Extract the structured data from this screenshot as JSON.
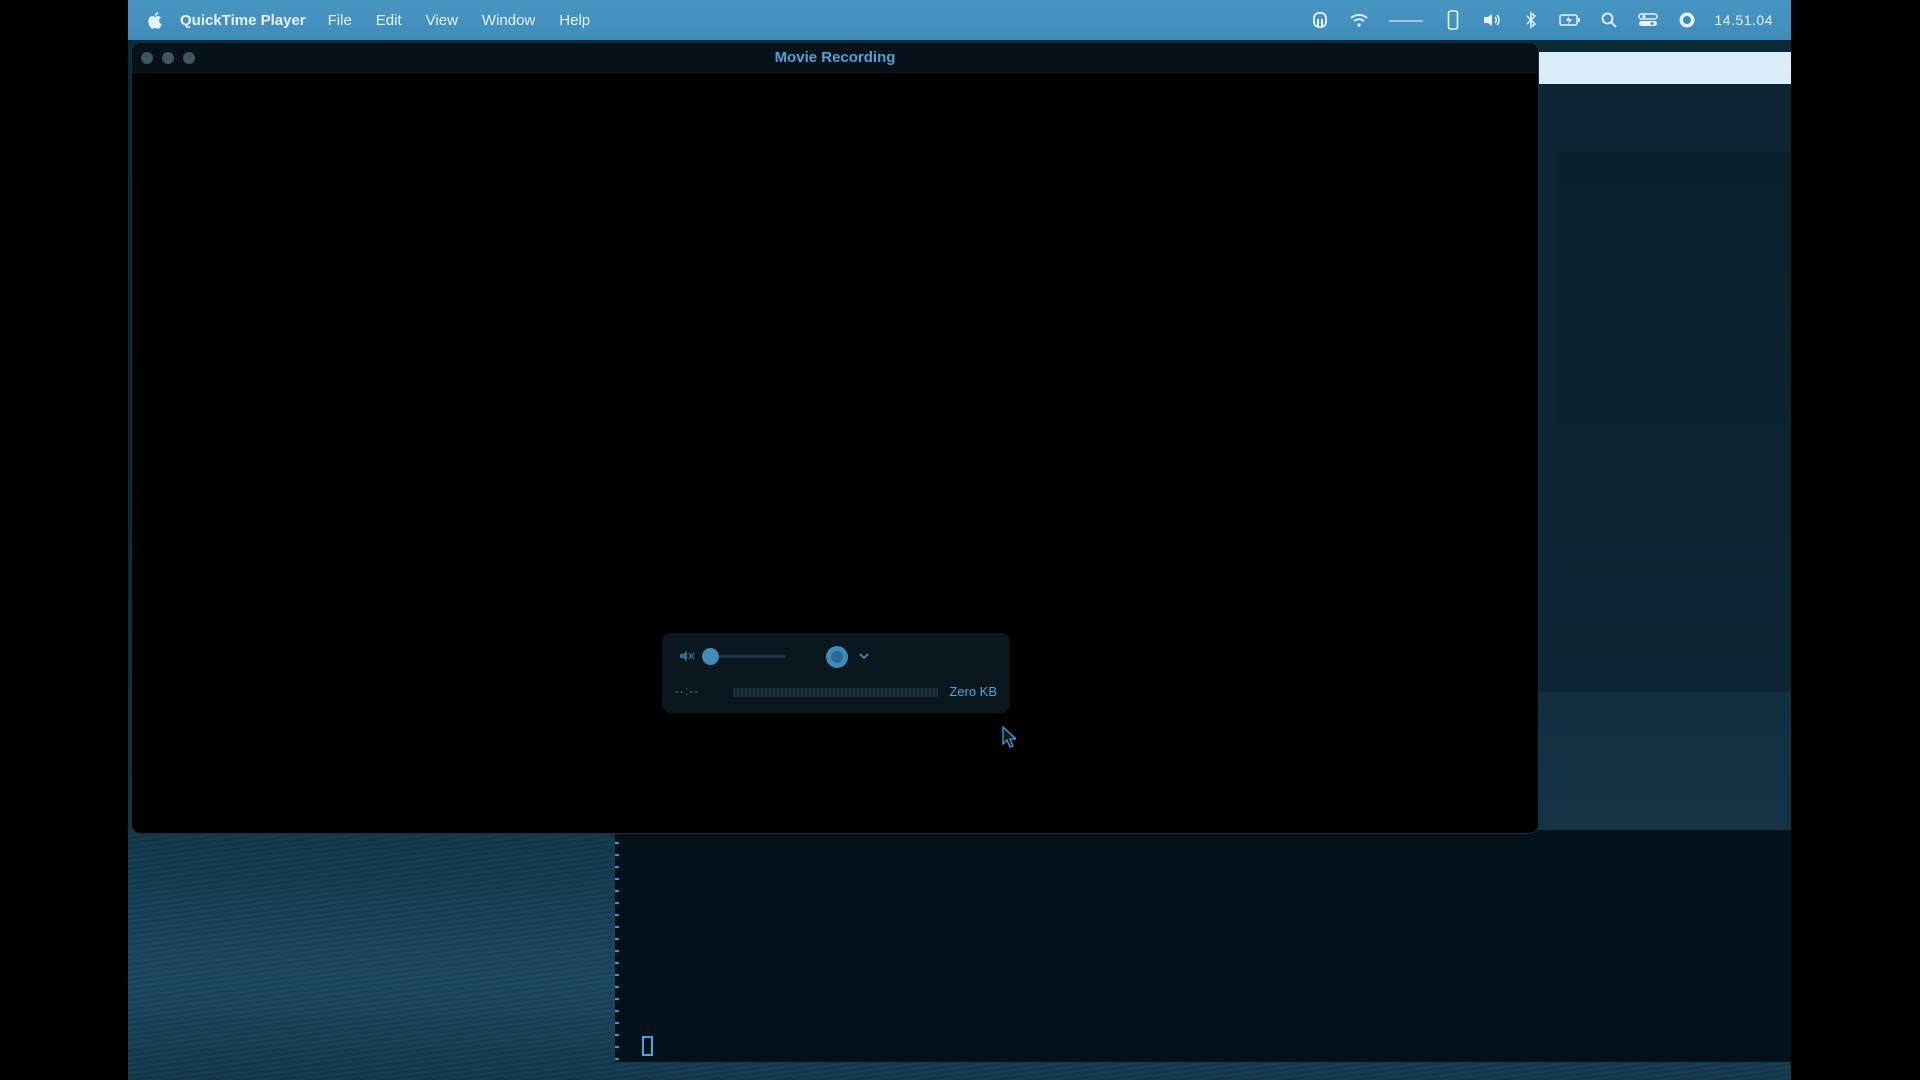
{
  "menubar": {
    "app_name": "QuickTime Player",
    "items": [
      "File",
      "Edit",
      "View",
      "Window",
      "Help"
    ],
    "clock": "14.51.04",
    "status_icons": [
      "airpods-icon",
      "wifi-icon",
      "battery-bar-icon",
      "phone-icon",
      "volume-icon",
      "bluetooth-icon",
      "battery-charging-icon",
      "search-icon",
      "control-center-icon",
      "siri-icon"
    ]
  },
  "window": {
    "title": "Movie Recording"
  },
  "recorder": {
    "elapsed": "--:--",
    "file_size": "Zero KB",
    "volume_level": 0
  },
  "colors": {
    "menubar": "#4a96c3",
    "accent": "#4aa6d8"
  }
}
